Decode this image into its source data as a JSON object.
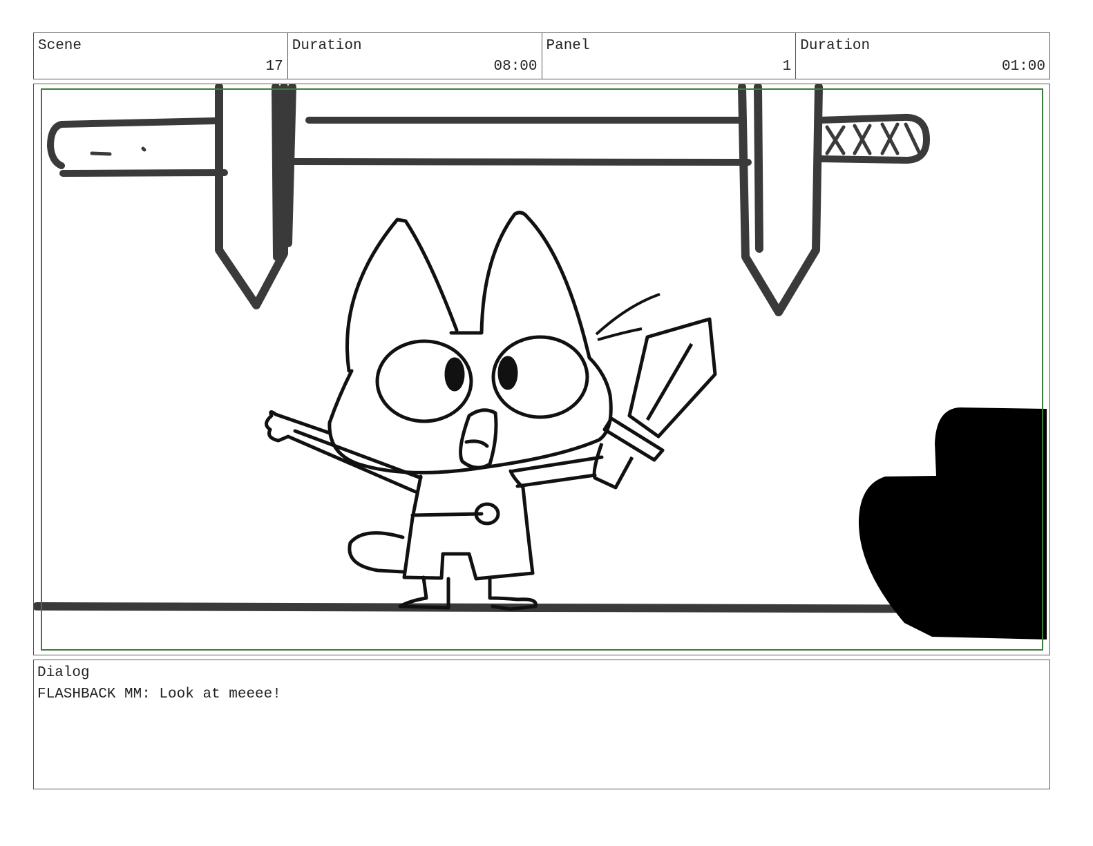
{
  "header": {
    "scene_label": "Scene",
    "scene_value": "17",
    "duration_label": "Duration",
    "duration_value": "08:00",
    "panel_label": "Panel",
    "panel_value": "1",
    "panel_duration_label": "Duration",
    "panel_duration_value": "01:00"
  },
  "dialog": {
    "label": "Dialog",
    "text": "FLASHBACK MM: Look at meeee!"
  },
  "colors": {
    "safe_frame": "#3a7d3a",
    "ink": "#111111",
    "background_ink": "#3a3a3a"
  }
}
